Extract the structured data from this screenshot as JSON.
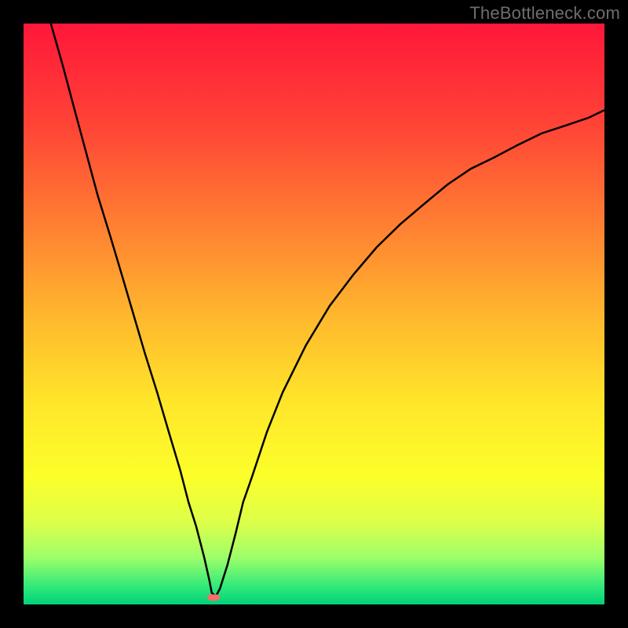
{
  "watermark": "TheBottleneck.com",
  "chart_data": {
    "type": "line",
    "title": "",
    "xlabel": "",
    "ylabel": "",
    "xlim": [
      0,
      100
    ],
    "ylim": [
      0,
      100
    ],
    "grid": false,
    "legend": false,
    "background_gradient": {
      "stops": [
        {
          "offset": 0.0,
          "color": "#ff173a"
        },
        {
          "offset": 0.17,
          "color": "#ff4236"
        },
        {
          "offset": 0.34,
          "color": "#ff7d32"
        },
        {
          "offset": 0.5,
          "color": "#ffb62e"
        },
        {
          "offset": 0.65,
          "color": "#ffe52a"
        },
        {
          "offset": 0.78,
          "color": "#fcff2a"
        },
        {
          "offset": 0.86,
          "color": "#dcff4a"
        },
        {
          "offset": 0.92,
          "color": "#9cff6a"
        },
        {
          "offset": 0.97,
          "color": "#30e87a"
        },
        {
          "offset": 1.0,
          "color": "#00d27a"
        }
      ]
    },
    "marker": {
      "x": 32.7,
      "y": 1.2,
      "color": "#ff6b6b"
    },
    "series": [
      {
        "name": "curve",
        "color": "#000000",
        "x": [
          4.7,
          6.8,
          8.8,
          10.8,
          12.8,
          14.9,
          16.9,
          18.9,
          20.9,
          23.0,
          25.0,
          27.0,
          28.4,
          29.7,
          31.1,
          32.0,
          32.4,
          33.1,
          33.8,
          35.1,
          36.5,
          37.8,
          39.2,
          41.9,
          44.6,
          48.6,
          52.7,
          56.8,
          60.8,
          64.9,
          68.9,
          73.0,
          77.0,
          81.1,
          85.1,
          89.2,
          93.2,
          97.3,
          100.0
        ],
        "y": [
          100.0,
          92.6,
          85.1,
          77.7,
          70.3,
          63.5,
          56.8,
          50.0,
          43.2,
          36.5,
          29.7,
          23.0,
          17.6,
          13.5,
          8.1,
          4.1,
          2.0,
          1.4,
          2.7,
          6.8,
          12.2,
          17.6,
          21.6,
          29.7,
          36.5,
          44.6,
          51.4,
          56.8,
          61.5,
          65.5,
          68.9,
          72.3,
          75.0,
          77.0,
          79.1,
          81.1,
          82.4,
          83.8,
          85.1
        ]
      }
    ]
  }
}
